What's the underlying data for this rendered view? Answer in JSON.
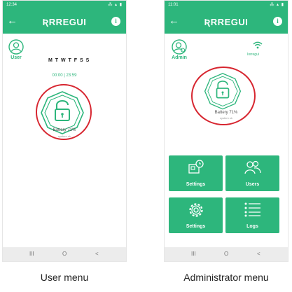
{
  "user_phone": {
    "status": {
      "time": "12:34",
      "right": "⁂ ▴ ▮"
    },
    "brand": "ƦRREGUI",
    "role": "User",
    "days": "M T W T F S S",
    "schedule": "00:00 | 23:59",
    "battery": "Battery 71%",
    "sub": "system ok",
    "nav": [
      "III",
      "O",
      "<"
    ]
  },
  "admin_phone": {
    "status": {
      "time": "11:01",
      "right": "⁂ ▴ ▮"
    },
    "brand": "ƦRREGUI",
    "role": "Admin",
    "network": "Iorregui",
    "battery": "Battery 71%",
    "sub": "system ok",
    "tiles": [
      "Settings",
      "Users",
      "Settings",
      "Logs"
    ],
    "nav": [
      "III",
      "O",
      "<"
    ]
  },
  "captions": {
    "user": "User menu",
    "admin": "Administrator menu"
  },
  "colors": {
    "accent": "#2db67c",
    "highlight_ring": "#d72630"
  }
}
